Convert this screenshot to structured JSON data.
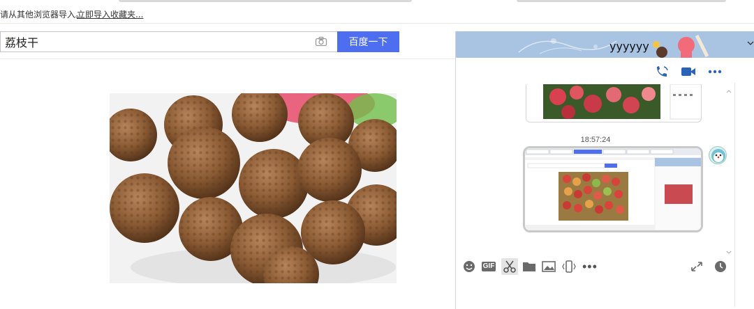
{
  "import_bar": {
    "text": "请从其他浏览器导入。",
    "link": "立即导入收藏夹..."
  },
  "search": {
    "query": "荔枝干",
    "button_label": "百度一下"
  },
  "chat": {
    "title": "yyyyyy",
    "timestamp": "18:57:24"
  },
  "icons": {
    "header": [
      "phone-icon",
      "video-call-icon",
      "more-icon"
    ],
    "toolbar": [
      "emoji-icon",
      "gif-icon",
      "screenshot-scissors-icon",
      "folder-icon",
      "image-icon",
      "shake-icon",
      "more-icon",
      "expand-icon",
      "history-clock-icon"
    ],
    "gif_label": "GIF",
    "dots": "•••"
  },
  "colors": {
    "accent": "#4e6ef2",
    "chat_header": "#a9c3e3",
    "chat_icon": "#2a63b8"
  }
}
